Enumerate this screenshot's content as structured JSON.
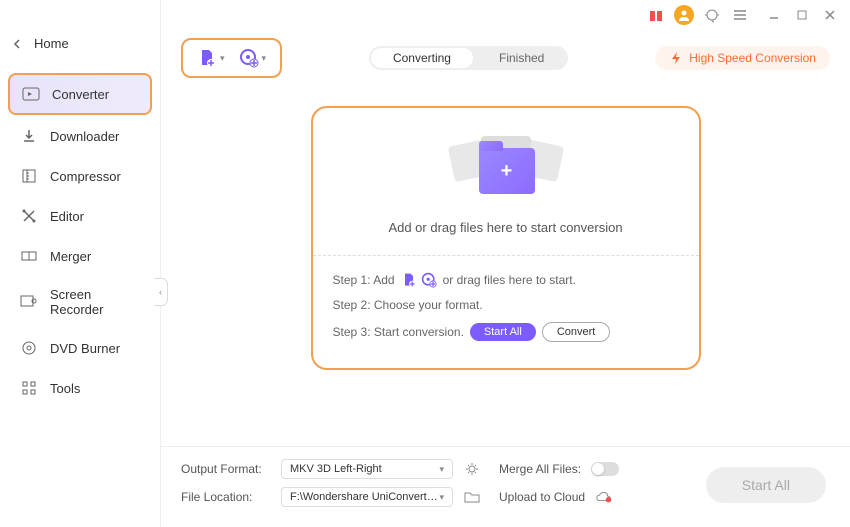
{
  "sidebar": {
    "home": "Home",
    "items": [
      {
        "label": "Converter"
      },
      {
        "label": "Downloader"
      },
      {
        "label": "Compressor"
      },
      {
        "label": "Editor"
      },
      {
        "label": "Merger"
      },
      {
        "label": "Screen Recorder"
      },
      {
        "label": "DVD Burner"
      },
      {
        "label": "Tools"
      }
    ]
  },
  "tabs": {
    "converting": "Converting",
    "finished": "Finished"
  },
  "hsc": "High Speed Conversion",
  "dropzone": {
    "main_text": "Add or drag files here to start conversion",
    "step1_a": "Step 1: Add",
    "step1_b": "or drag files here to start.",
    "step2": "Step 2: Choose your format.",
    "step3": "Step 3: Start conversion.",
    "start_all": "Start All",
    "convert": "Convert"
  },
  "bottom": {
    "output_format_label": "Output Format:",
    "output_format_value": "MKV 3D Left-Right",
    "merge_label": "Merge All Files:",
    "file_location_label": "File Location:",
    "file_location_value": "F:\\Wondershare UniConverter 1",
    "upload_label": "Upload to Cloud"
  },
  "start_all_button": "Start All"
}
